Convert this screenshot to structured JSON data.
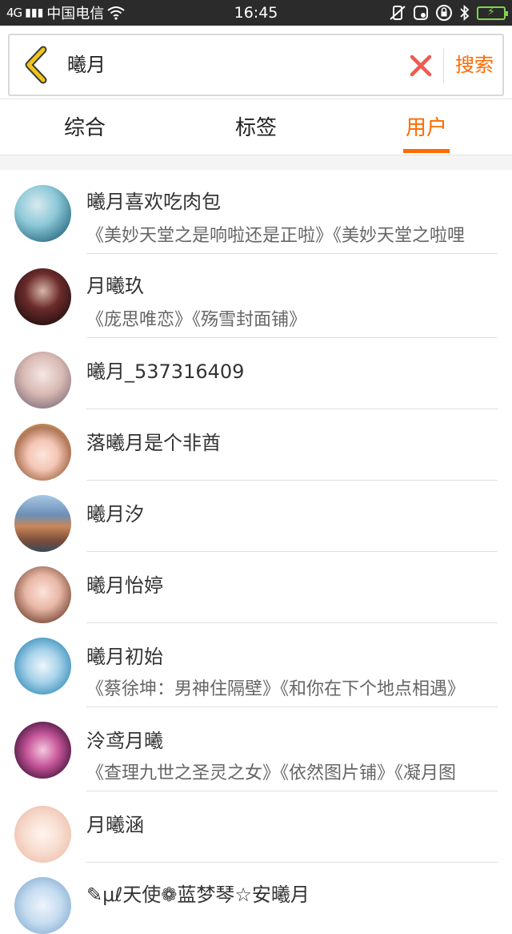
{
  "status_bar": {
    "signal": "4G",
    "carrier": "中国电信",
    "time": "16:45"
  },
  "search": {
    "query": "曦月",
    "search_label": "搜索"
  },
  "tabs": [
    {
      "label": "综合",
      "active": false
    },
    {
      "label": "标签",
      "active": false
    },
    {
      "label": "用户",
      "active": true
    }
  ],
  "colors": {
    "accent": "#ff6a00",
    "back_arrow": "#f0c419",
    "clear_x": "#f05a4f"
  },
  "users": [
    {
      "name": "曦月喜欢吃肉包",
      "works": "《美妙天堂之是响啦还是正啦》《美妙天堂之啦哩"
    },
    {
      "name": "月曦玖",
      "works": "《庞思唯恋》《殇雪封面铺》"
    },
    {
      "name": "曦月_537316409",
      "works": ""
    },
    {
      "name": "落曦月是个非酋",
      "works": ""
    },
    {
      "name": "曦月汐",
      "works": ""
    },
    {
      "name": "曦月怡婷",
      "works": ""
    },
    {
      "name": "曦月初始",
      "works": "《蔡徐坤：男神住隔壁》《和你在下个地点相遇》"
    },
    {
      "name": "泠鸢月曦",
      "works": "《查理九世之圣灵之女》《依然图片铺》《凝月图"
    },
    {
      "name": "月曦涵",
      "works": ""
    },
    {
      "name": "✎μℓ天使❁蓝梦琴☆安曦月",
      "works": ""
    }
  ]
}
